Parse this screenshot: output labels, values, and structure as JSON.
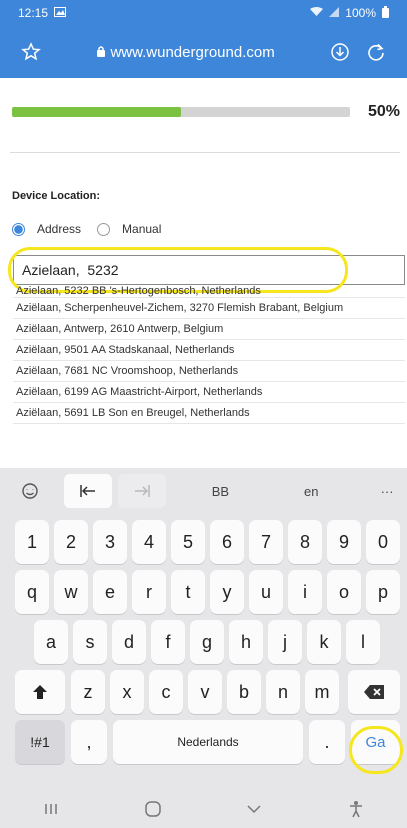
{
  "status": {
    "time": "12:15",
    "battery": "100%"
  },
  "browser": {
    "url": "www.wunderground.com"
  },
  "progress": {
    "fraction": 0.5,
    "label": "50%"
  },
  "location": {
    "heading": "Device Location:",
    "options": [
      "Address",
      "Manual"
    ],
    "selected": "Address",
    "input_value": "Azielaan,  5232",
    "suggestions": [
      "Azielaan, 5232 BB 's-Hertogenbosch, Netherlands",
      "Aziëlaan, Scherpenheuvel-Zichem, 3270 Flemish Brabant, Belgium",
      "Aziëlaan, Antwerp, 2610 Antwerp, Belgium",
      "Aziëlaan, 9501 AA Stadskanaal, Netherlands",
      "Aziëlaan, 7681 NC Vroomshoop, Netherlands",
      "Aziëlaan, 6199 AG Maastricht-Airport, Netherlands",
      "Aziëlaan, 5691 LB Son en Breugel, Netherlands"
    ]
  },
  "keyboard": {
    "toolbar": {
      "bb": "BB",
      "lang": "en",
      "more": "···"
    },
    "digits": [
      "1",
      "2",
      "3",
      "4",
      "5",
      "6",
      "7",
      "8",
      "9",
      "0"
    ],
    "row1": [
      "q",
      "w",
      "e",
      "r",
      "t",
      "y",
      "u",
      "i",
      "o",
      "p"
    ],
    "row2": [
      "a",
      "s",
      "d",
      "f",
      "g",
      "h",
      "j",
      "k",
      "l"
    ],
    "row3": [
      "z",
      "x",
      "c",
      "v",
      "b",
      "n",
      "m"
    ],
    "symbols_key": "!#1",
    "comma_key": ",",
    "space_label": "Nederlands",
    "period_key": ".",
    "go_key": "Ga"
  },
  "colors": {
    "accent": "#3d86d9",
    "progress": "#7cc241",
    "highlight": "#f6e61d"
  }
}
